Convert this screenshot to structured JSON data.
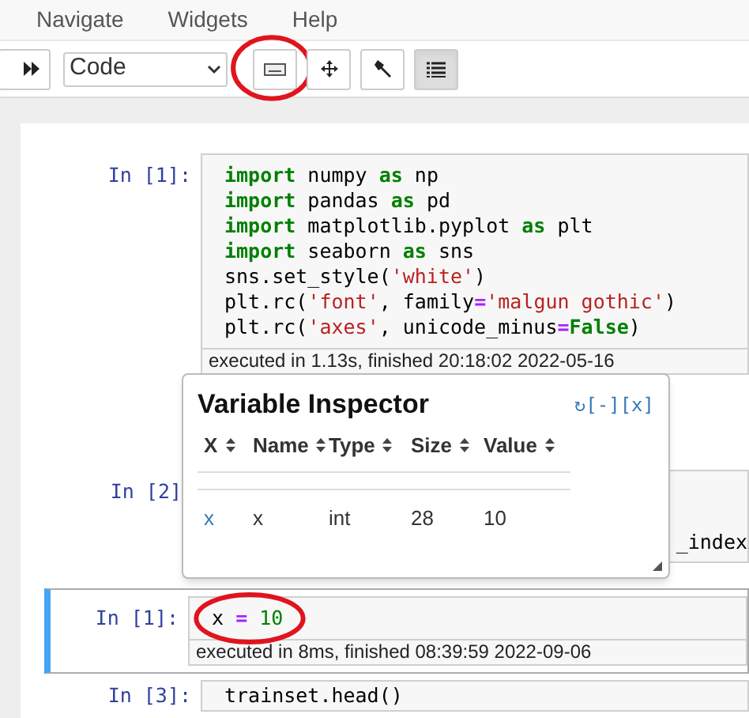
{
  "menu": [
    "Navigate",
    "Widgets",
    "Help"
  ],
  "toolbar": {
    "cell_type": "Code",
    "buttons": [
      {
        "kind": "run-all",
        "selected": false,
        "circled": false
      },
      {
        "kind": "keyboard",
        "selected": false,
        "circled": true
      },
      {
        "kind": "move",
        "selected": false,
        "circled": false
      },
      {
        "kind": "wrench",
        "selected": false,
        "circled": false
      },
      {
        "kind": "list",
        "selected": true,
        "circled": false
      }
    ]
  },
  "cells": [
    {
      "prompt": "In [1]:",
      "selected": false,
      "circled": false,
      "lines": [
        [
          {
            "kind": "keyword",
            "text": "import"
          },
          {
            "kind": "plain",
            "text": " numpy "
          },
          {
            "kind": "keyword",
            "text": "as"
          },
          {
            "kind": "plain",
            "text": " np"
          }
        ],
        [
          {
            "kind": "keyword",
            "text": "import"
          },
          {
            "kind": "plain",
            "text": " pandas "
          },
          {
            "kind": "keyword",
            "text": "as"
          },
          {
            "kind": "plain",
            "text": " pd"
          }
        ],
        [
          {
            "kind": "keyword",
            "text": "import"
          },
          {
            "kind": "plain",
            "text": " matplotlib.pyplot "
          },
          {
            "kind": "keyword",
            "text": "as"
          },
          {
            "kind": "plain",
            "text": " plt"
          }
        ],
        [
          {
            "kind": "keyword",
            "text": "import"
          },
          {
            "kind": "plain",
            "text": " seaborn "
          },
          {
            "kind": "keyword",
            "text": "as"
          },
          {
            "kind": "plain",
            "text": " sns"
          }
        ],
        [
          {
            "kind": "plain",
            "text": "sns.set_style("
          },
          {
            "kind": "string",
            "text": "'white'"
          },
          {
            "kind": "plain",
            "text": ")"
          }
        ],
        [
          {
            "kind": "plain",
            "text": "plt.rc("
          },
          {
            "kind": "string",
            "text": "'font'"
          },
          {
            "kind": "plain",
            "text": ", family"
          },
          {
            "kind": "operator",
            "text": "="
          },
          {
            "kind": "string",
            "text": "'malgun gothic'"
          },
          {
            "kind": "plain",
            "text": ")"
          }
        ],
        [
          {
            "kind": "plain",
            "text": "plt.rc("
          },
          {
            "kind": "string",
            "text": "'axes'"
          },
          {
            "kind": "plain",
            "text": ", unicode_minus"
          },
          {
            "kind": "operator",
            "text": "="
          },
          {
            "kind": "keyword",
            "text": "False"
          },
          {
            "kind": "plain",
            "text": ")"
          }
        ]
      ],
      "executed": "executed in 1.13s, finished 20:18:02 2022-05-16"
    },
    {
      "prompt": "In [2]",
      "selected": false,
      "circled": false,
      "lines": [
        [
          {
            "kind": "plain",
            "text": "_index"
          }
        ]
      ]
    },
    {
      "prompt": "In [1]:",
      "selected": true,
      "circled": true,
      "lines": [
        [
          {
            "kind": "plain",
            "text": "x "
          },
          {
            "kind": "operator",
            "text": "="
          },
          {
            "kind": "number",
            "text": " 10"
          }
        ]
      ],
      "executed": "executed in 8ms, finished 08:39:59 2022-09-06"
    },
    {
      "prompt": "In [3]:",
      "selected": false,
      "circled": false,
      "lines": [
        [
          {
            "kind": "plain",
            "text": "trainset.head()"
          }
        ]
      ]
    }
  ],
  "inspector": {
    "title": "Variable Inspector",
    "controls": "↻[-][x]",
    "columns": [
      "X",
      "Name",
      "Type",
      "Size",
      "Value"
    ],
    "rows": [
      [
        "x",
        "x",
        "int",
        "28",
        "10"
      ]
    ]
  }
}
